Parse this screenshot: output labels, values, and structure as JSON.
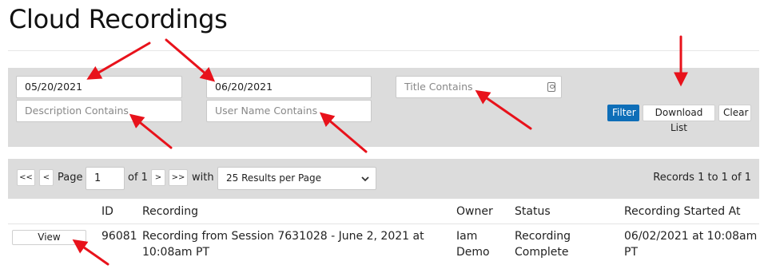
{
  "page": {
    "title": "Cloud Recordings"
  },
  "filters": {
    "start_date": "05/20/2021",
    "end_date": "06/20/2021",
    "title_placeholder": "Title Contains",
    "description_placeholder": "Description Contains",
    "user_name_placeholder": "User Name Contains",
    "filter_label": "Filter",
    "download_label": "Download List",
    "clear_label": "Clear"
  },
  "pager": {
    "first": "<<",
    "prev": "<",
    "page_label": "Page",
    "page_value": "1",
    "of_label": "of 1",
    "next": ">",
    "last": ">>",
    "with_label": "with",
    "per_page_selected": "25 Results per Page",
    "records_summary": "Records 1 to 1 of 1"
  },
  "table": {
    "columns": [
      "ID",
      "Recording",
      "Owner",
      "Status",
      "Recording Started At"
    ],
    "rows": [
      {
        "action": "View",
        "id": "96081",
        "recording_line1": "Recording from Session 7631028 - June 2, 2021 at",
        "recording_line2": "10:08am PT",
        "owner_line1": "Iam",
        "owner_line2": "Demo",
        "status_line1": "Recording",
        "status_line2": "Complete",
        "started_line1": "06/02/2021 at 10:08am",
        "started_line2": "PT"
      }
    ]
  },
  "colors": {
    "accent": "#0e6eb8",
    "annotation_arrow": "#e8121b",
    "panel": "#dcdcdc"
  }
}
